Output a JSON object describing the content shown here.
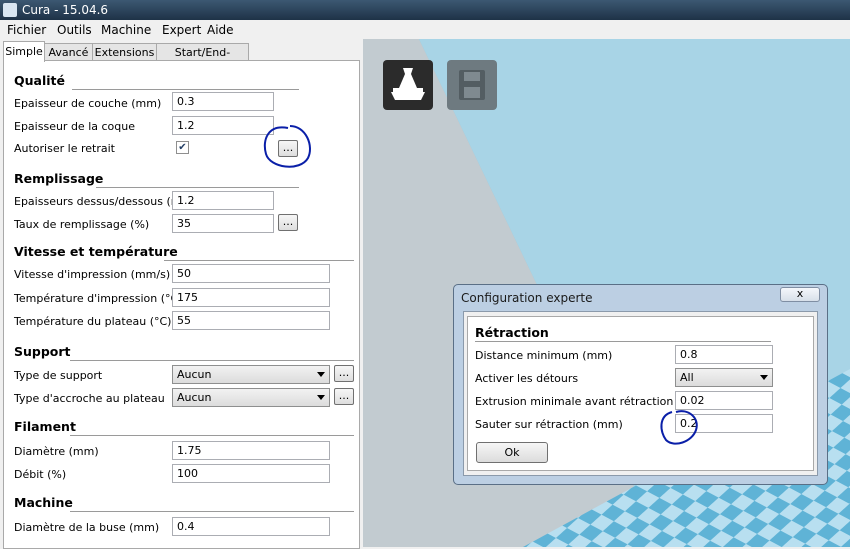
{
  "window": {
    "title": "Cura - 15.04.6"
  },
  "menu": [
    "Fichier",
    "Outils",
    "Machine",
    "Expert",
    "Aide"
  ],
  "tabs": [
    "Simple",
    "Avancé",
    "Extensions",
    "Start/End-GCode"
  ],
  "sections": {
    "quality": {
      "title": "Qualité",
      "layer_height_label": "Epaisseur de couche (mm)",
      "layer_height": "0.3",
      "shell_label": "Epaisseur de la coque",
      "shell": "1.2",
      "retraction_label": "Autoriser le retrait",
      "retraction_checked": true
    },
    "fill": {
      "title": "Remplissage",
      "bottom_top_label": "Epaisseurs dessus/dessous (mm)",
      "bottom_top": "1.2",
      "density_label": "Taux de remplissage (%)",
      "density": "35"
    },
    "speed": {
      "title": "Vitesse et température",
      "print_speed_label": "Vitesse d'impression (mm/s)",
      "print_speed": "50",
      "print_temp_label": "Température d'impression (°C)",
      "print_temp": "175",
      "bed_temp_label": "Température du plateau (°C)",
      "bed_temp": "55"
    },
    "support": {
      "title": "Support",
      "type_label": "Type de support",
      "type": "Aucun",
      "adhesion_label": "Type d'accroche au plateau",
      "adhesion": "Aucun"
    },
    "filament": {
      "title": "Filament",
      "diameter_label": "Diamètre (mm)",
      "diameter": "1.75",
      "flow_label": "Débit (%)",
      "flow": "100"
    },
    "machine": {
      "title": "Machine",
      "nozzle_label": "Diamètre de la buse (mm)",
      "nozzle": "0.4"
    }
  },
  "buttons": {
    "more": "..."
  },
  "dialog": {
    "title": "Configuration experte",
    "close": "x",
    "section": "Rétraction",
    "min_distance_label": "Distance minimum (mm)",
    "min_distance": "0.8",
    "combing_label": "Activer les détours",
    "combing": "All",
    "min_extrusion_label": "Extrusion minimale avant rétraction (mm)",
    "min_extrusion": "0.02",
    "hop_label": "Sauter sur rétraction (mm)",
    "hop": "0.2",
    "ok": "Ok"
  },
  "colors": {
    "viewport_sky": "#8fc4d9",
    "floor_tile_light": "#b8dff0",
    "floor_tile_dark": "#5fb3d6",
    "annotation_ink": "#0a1fa8"
  },
  "icons": [
    "load-model-icon",
    "save-gcode-icon",
    "checkmark-icon"
  ]
}
